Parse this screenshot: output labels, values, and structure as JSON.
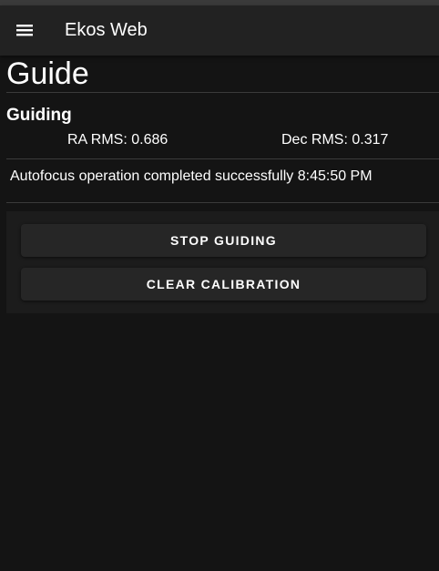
{
  "app_bar": {
    "menu_icon": "menu-icon",
    "title": "Ekos Web"
  },
  "page": {
    "title": "Guide"
  },
  "guiding": {
    "heading": "Guiding",
    "ra_rms": "RA RMS: 0.686",
    "dec_rms": "Dec RMS: 0.317"
  },
  "status": {
    "message": "Autofocus operation completed successfully 8:45:50 PM"
  },
  "actions": {
    "stop_label": "STOP GUIDING",
    "clear_label": "CLEAR CALIBRATION"
  },
  "colors": {
    "background": "#141414",
    "app_bar": "#222222",
    "panel": "#1c1c1c",
    "button": "#262626",
    "text": "#ffffff"
  }
}
